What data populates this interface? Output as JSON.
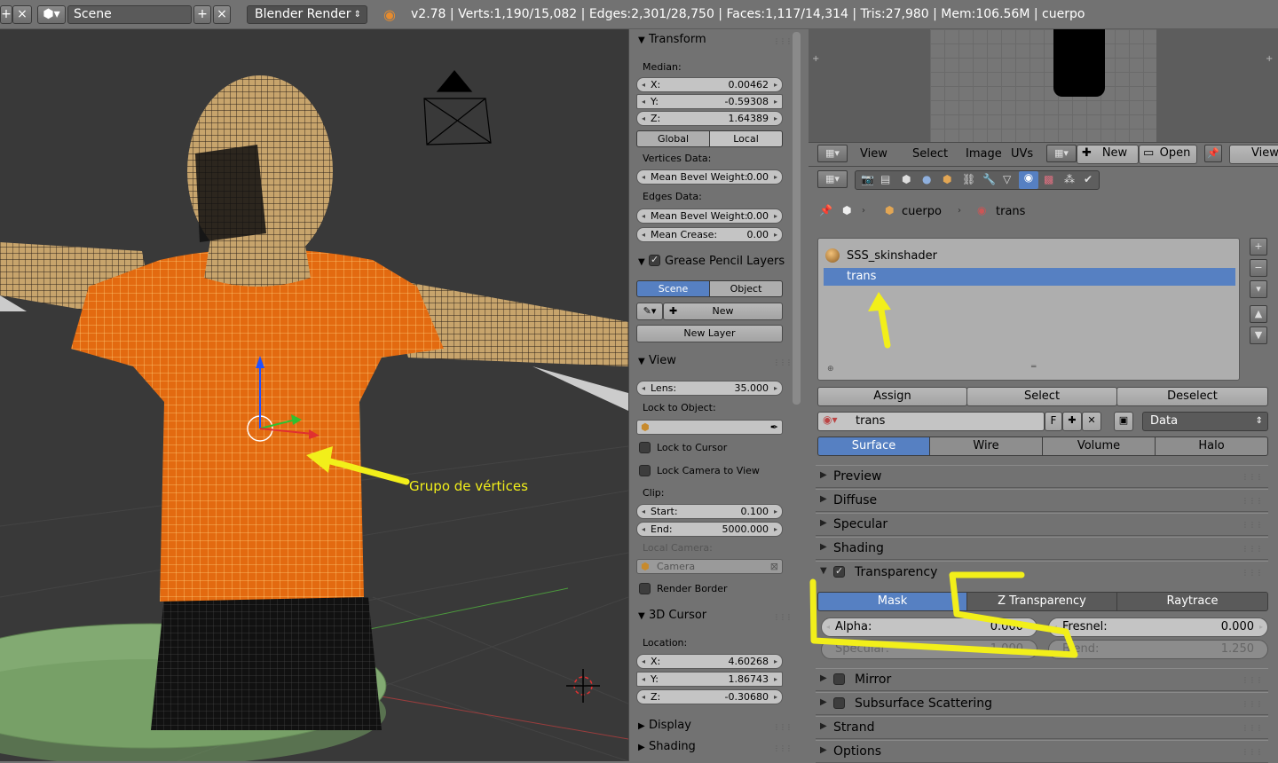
{
  "topbar": {
    "scene_icon": "scene-icon",
    "scene_name": "Scene",
    "render_engine": "Blender Render",
    "stats": "v2.78 | Verts:1,190/15,082 | Edges:2,301/28,750 | Faces:1,117/14,314 | Tris:27,980 | Mem:106.56M | cuerpo"
  },
  "viewport": {
    "annotation": "Grupo de vértices"
  },
  "npanel": {
    "transform": {
      "title": "Transform",
      "median_label": "Median:",
      "x_key": "X:",
      "x_val": "0.00462",
      "y_key": "Y:",
      "y_val": "-0.59308",
      "z_key": "Z:",
      "z_val": "1.64389",
      "global": "Global",
      "local": "Local",
      "vertices_data": "Vertices Data:",
      "v_bevel_key": "Mean Bevel Weight:",
      "v_bevel_val": "0.00",
      "edges_data": "Edges Data:",
      "e_bevel_key": "Mean Bevel Weight:",
      "e_bevel_val": "0.00",
      "crease_key": "Mean Crease:",
      "crease_val": "0.00"
    },
    "grease": {
      "title": "Grease Pencil Layers",
      "scene": "Scene",
      "object": "Object",
      "new": "New",
      "new_layer": "New Layer"
    },
    "view": {
      "title": "View",
      "lens_key": "Lens:",
      "lens_val": "35.000",
      "lock_obj": "Lock to Object:",
      "lock_cursor": "Lock to Cursor",
      "lock_camera": "Lock Camera to View",
      "clip": "Clip:",
      "start_key": "Start:",
      "start_val": "0.100",
      "end_key": "End:",
      "end_val": "5000.000",
      "local_camera": "Local Camera:",
      "camera": "Camera",
      "render_border": "Render Border"
    },
    "cursor": {
      "title": "3D Cursor",
      "location": "Location:",
      "x_key": "X:",
      "x_val": "4.60268",
      "y_key": "Y:",
      "y_val": "1.86743",
      "z_key": "Z:",
      "z_val": "-0.30680"
    },
    "display": "Display",
    "shading": "Shading"
  },
  "image_header": {
    "view": "View",
    "select": "Select",
    "image": "Image",
    "uvs": "UVs",
    "new": "New",
    "open": "Open",
    "view2": "View"
  },
  "props": {
    "breadcrumb_obj": "cuerpo",
    "breadcrumb_mat": "trans",
    "slots": [
      "SSS_skinshader",
      "trans"
    ],
    "assign": "Assign",
    "select": "Select",
    "deselect": "Deselect",
    "material_name": "trans",
    "fake_user": "F",
    "link": "Data",
    "tabs": [
      "Surface",
      "Wire",
      "Volume",
      "Halo"
    ],
    "panels_top": [
      "Preview",
      "Diffuse",
      "Specular",
      "Shading"
    ],
    "transparency": "Transparency",
    "trans_modes": [
      "Mask",
      "Z Transparency",
      "Raytrace"
    ],
    "alpha_key": "Alpha:",
    "alpha_val": "0.000",
    "fresnel_key": "Fresnel:",
    "fresnel_val": "0.000",
    "specular_key": "Specular:",
    "specular_val": "1.000",
    "blend_key": "Blend:",
    "blend_val": "1.250",
    "panels_bottom": [
      "Mirror",
      "Subsurface Scattering",
      "Strand",
      "Options"
    ]
  },
  "colors": {
    "accent": "#5680c2",
    "annotation": "#f2ef1a",
    "mesh_selected": "#e36a10"
  }
}
